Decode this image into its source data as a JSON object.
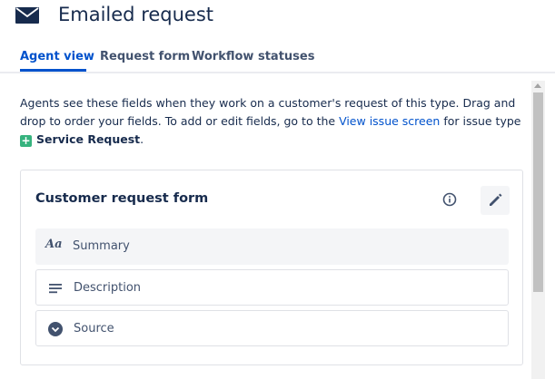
{
  "header": {
    "icon": "mail-icon",
    "title": "Emailed request"
  },
  "tabs": [
    {
      "label": "Agent view",
      "active": true
    },
    {
      "label": "Request form",
      "active": false
    },
    {
      "label": "Workflow statuses",
      "active": false
    }
  ],
  "description": {
    "text_before_link": "Agents see these fields when they work on a customer's request of this type. Drag and drop to order your fields. To add or edit fields, go to the ",
    "link": "View issue screen",
    "text_after_link": " for issue type",
    "issue_type_icon": "service-request-icon",
    "issue_type": "Service Request",
    "trailing": "."
  },
  "card": {
    "title": "Customer request form",
    "info_icon": "info-icon",
    "edit_icon": "pencil-icon",
    "fields": [
      {
        "label": "Summary",
        "icon": "text-aa-icon",
        "glyph": "Aa"
      },
      {
        "label": "Description",
        "icon": "paragraph-lines-icon"
      },
      {
        "label": "Source",
        "icon": "dropdown-chevron-icon"
      }
    ]
  },
  "colors": {
    "accent": "#0052cc",
    "text": "#172b4d",
    "subtle_text": "#42526e",
    "issue_type_green": "#36b37e",
    "border": "#dfe1e6",
    "field_bg": "#f4f5f7"
  }
}
